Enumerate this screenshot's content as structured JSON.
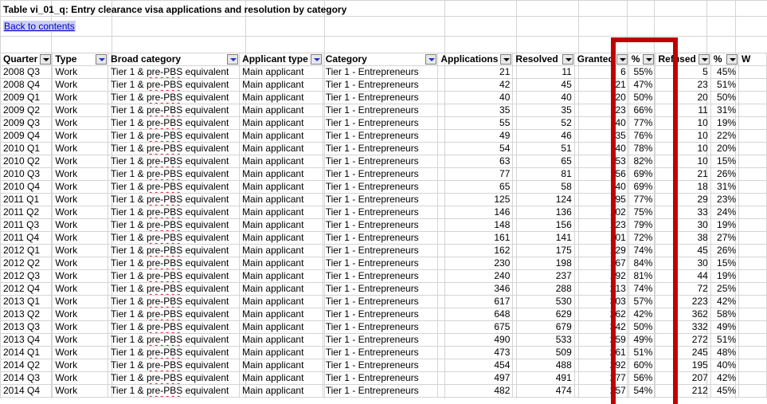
{
  "title": "Table vi_01_q: Entry clearance visa applications and resolution by category",
  "back_link": "Back to contents",
  "columns": [
    "Quarter",
    "Type",
    "Broad category",
    "Applicant type",
    "Category",
    "Applications",
    "Resolved",
    "Granted",
    "%",
    "Refused",
    "%",
    "W"
  ],
  "rows": [
    [
      "2008 Q3",
      "Work",
      "Tier 1 & pre-PBS equivalent",
      "Main applicant",
      "Tier 1 - Entrepreneurs",
      "21",
      "11",
      "6",
      "55%",
      "5",
      "45%"
    ],
    [
      "2008 Q4",
      "Work",
      "Tier 1 & pre-PBS equivalent",
      "Main applicant",
      "Tier 1 - Entrepreneurs",
      "42",
      "45",
      "21",
      "47%",
      "23",
      "51%"
    ],
    [
      "2009 Q1",
      "Work",
      "Tier 1 & pre-PBS equivalent",
      "Main applicant",
      "Tier 1 - Entrepreneurs",
      "40",
      "40",
      "20",
      "50%",
      "20",
      "50%"
    ],
    [
      "2009 Q2",
      "Work",
      "Tier 1 & pre-PBS equivalent",
      "Main applicant",
      "Tier 1 - Entrepreneurs",
      "35",
      "35",
      "23",
      "66%",
      "11",
      "31%"
    ],
    [
      "2009 Q3",
      "Work",
      "Tier 1 & pre-PBS equivalent",
      "Main applicant",
      "Tier 1 - Entrepreneurs",
      "55",
      "52",
      "40",
      "77%",
      "10",
      "19%"
    ],
    [
      "2009 Q4",
      "Work",
      "Tier 1 & pre-PBS equivalent",
      "Main applicant",
      "Tier 1 - Entrepreneurs",
      "49",
      "46",
      "35",
      "76%",
      "10",
      "22%"
    ],
    [
      "2010 Q1",
      "Work",
      "Tier 1 & pre-PBS equivalent",
      "Main applicant",
      "Tier 1 - Entrepreneurs",
      "54",
      "51",
      "40",
      "78%",
      "10",
      "20%"
    ],
    [
      "2010 Q2",
      "Work",
      "Tier 1 & pre-PBS equivalent",
      "Main applicant",
      "Tier 1 - Entrepreneurs",
      "63",
      "65",
      "53",
      "82%",
      "10",
      "15%"
    ],
    [
      "2010 Q3",
      "Work",
      "Tier 1 & pre-PBS equivalent",
      "Main applicant",
      "Tier 1 - Entrepreneurs",
      "77",
      "81",
      "56",
      "69%",
      "21",
      "26%"
    ],
    [
      "2010 Q4",
      "Work",
      "Tier 1 & pre-PBS equivalent",
      "Main applicant",
      "Tier 1 - Entrepreneurs",
      "65",
      "58",
      "40",
      "69%",
      "18",
      "31%"
    ],
    [
      "2011 Q1",
      "Work",
      "Tier 1 & pre-PBS equivalent",
      "Main applicant",
      "Tier 1 - Entrepreneurs",
      "125",
      "124",
      "95",
      "77%",
      "29",
      "23%"
    ],
    [
      "2011 Q2",
      "Work",
      "Tier 1 & pre-PBS equivalent",
      "Main applicant",
      "Tier 1 - Entrepreneurs",
      "146",
      "136",
      "102",
      "75%",
      "33",
      "24%"
    ],
    [
      "2011 Q3",
      "Work",
      "Tier 1 & pre-PBS equivalent",
      "Main applicant",
      "Tier 1 - Entrepreneurs",
      "148",
      "156",
      "123",
      "79%",
      "30",
      "19%"
    ],
    [
      "2011 Q4",
      "Work",
      "Tier 1 & pre-PBS equivalent",
      "Main applicant",
      "Tier 1 - Entrepreneurs",
      "161",
      "141",
      "101",
      "72%",
      "38",
      "27%"
    ],
    [
      "2012 Q1",
      "Work",
      "Tier 1 & pre-PBS equivalent",
      "Main applicant",
      "Tier 1 - Entrepreneurs",
      "162",
      "175",
      "129",
      "74%",
      "45",
      "26%"
    ],
    [
      "2012 Q2",
      "Work",
      "Tier 1 & pre-PBS equivalent",
      "Main applicant",
      "Tier 1 - Entrepreneurs",
      "230",
      "198",
      "167",
      "84%",
      "30",
      "15%"
    ],
    [
      "2012 Q3",
      "Work",
      "Tier 1 & pre-PBS equivalent",
      "Main applicant",
      "Tier 1 - Entrepreneurs",
      "240",
      "237",
      "192",
      "81%",
      "44",
      "19%"
    ],
    [
      "2012 Q4",
      "Work",
      "Tier 1 & pre-PBS equivalent",
      "Main applicant",
      "Tier 1 - Entrepreneurs",
      "346",
      "288",
      "213",
      "74%",
      "72",
      "25%"
    ],
    [
      "2013 Q1",
      "Work",
      "Tier 1 & pre-PBS equivalent",
      "Main applicant",
      "Tier 1 - Entrepreneurs",
      "617",
      "530",
      "303",
      "57%",
      "223",
      "42%"
    ],
    [
      "2013 Q2",
      "Work",
      "Tier 1 & pre-PBS equivalent",
      "Main applicant",
      "Tier 1 - Entrepreneurs",
      "648",
      "629",
      "262",
      "42%",
      "362",
      "58%"
    ],
    [
      "2013 Q3",
      "Work",
      "Tier 1 & pre-PBS equivalent",
      "Main applicant",
      "Tier 1 - Entrepreneurs",
      "675",
      "679",
      "342",
      "50%",
      "332",
      "49%"
    ],
    [
      "2013 Q4",
      "Work",
      "Tier 1 & pre-PBS equivalent",
      "Main applicant",
      "Tier 1 - Entrepreneurs",
      "490",
      "533",
      "259",
      "49%",
      "272",
      "51%"
    ],
    [
      "2014 Q1",
      "Work",
      "Tier 1 & pre-PBS equivalent",
      "Main applicant",
      "Tier 1 - Entrepreneurs",
      "473",
      "509",
      "261",
      "51%",
      "245",
      "48%"
    ],
    [
      "2014 Q2",
      "Work",
      "Tier 1 & pre-PBS equivalent",
      "Main applicant",
      "Tier 1 - Entrepreneurs",
      "454",
      "488",
      "292",
      "60%",
      "195",
      "40%"
    ],
    [
      "2014 Q3",
      "Work",
      "Tier 1 & pre-PBS equivalent",
      "Main applicant",
      "Tier 1 - Entrepreneurs",
      "497",
      "491",
      "277",
      "56%",
      "207",
      "42%"
    ],
    [
      "2014 Q4",
      "Work",
      "Tier 1 & pre-PBS equivalent",
      "Main applicant",
      "Tier 1 - Entrepreneurs",
      "482",
      "474",
      "257",
      "54%",
      "212",
      "45%"
    ]
  ],
  "colors": {
    "highlight_box": "#c00000",
    "link": "#0000cc",
    "gridline": "#d4d4d4"
  }
}
